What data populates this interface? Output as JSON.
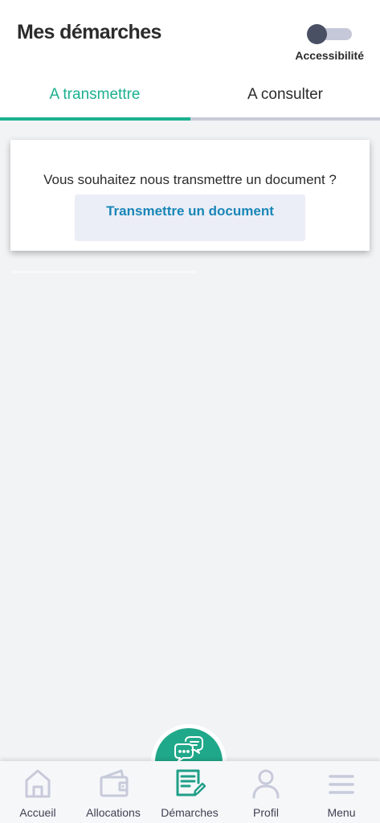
{
  "header": {
    "title": "Mes démarches",
    "accessibility_label": "Accessibilité"
  },
  "tabs": [
    {
      "label": "A transmettre",
      "active": true
    },
    {
      "label": "A consulter",
      "active": false
    }
  ],
  "card": {
    "prompt": "Vous souhaitez nous transmettre un document ?",
    "button_label": "Transmettre un document"
  },
  "bottom_nav": {
    "items": [
      {
        "label": "Accueil",
        "icon": "home-icon"
      },
      {
        "label": "Allocations",
        "icon": "wallet-icon"
      },
      {
        "label": "Démarches",
        "icon": "document-edit-icon",
        "active": true
      },
      {
        "label": "Profil",
        "icon": "user-icon"
      },
      {
        "label": "Menu",
        "icon": "menu-icon"
      }
    ]
  },
  "fab": {
    "icon": "chat-icon"
  },
  "colors": {
    "accent": "#1bb08f",
    "fab": "#20a88a",
    "link": "#1a86b8",
    "nav_icon": "#c6cada"
  }
}
